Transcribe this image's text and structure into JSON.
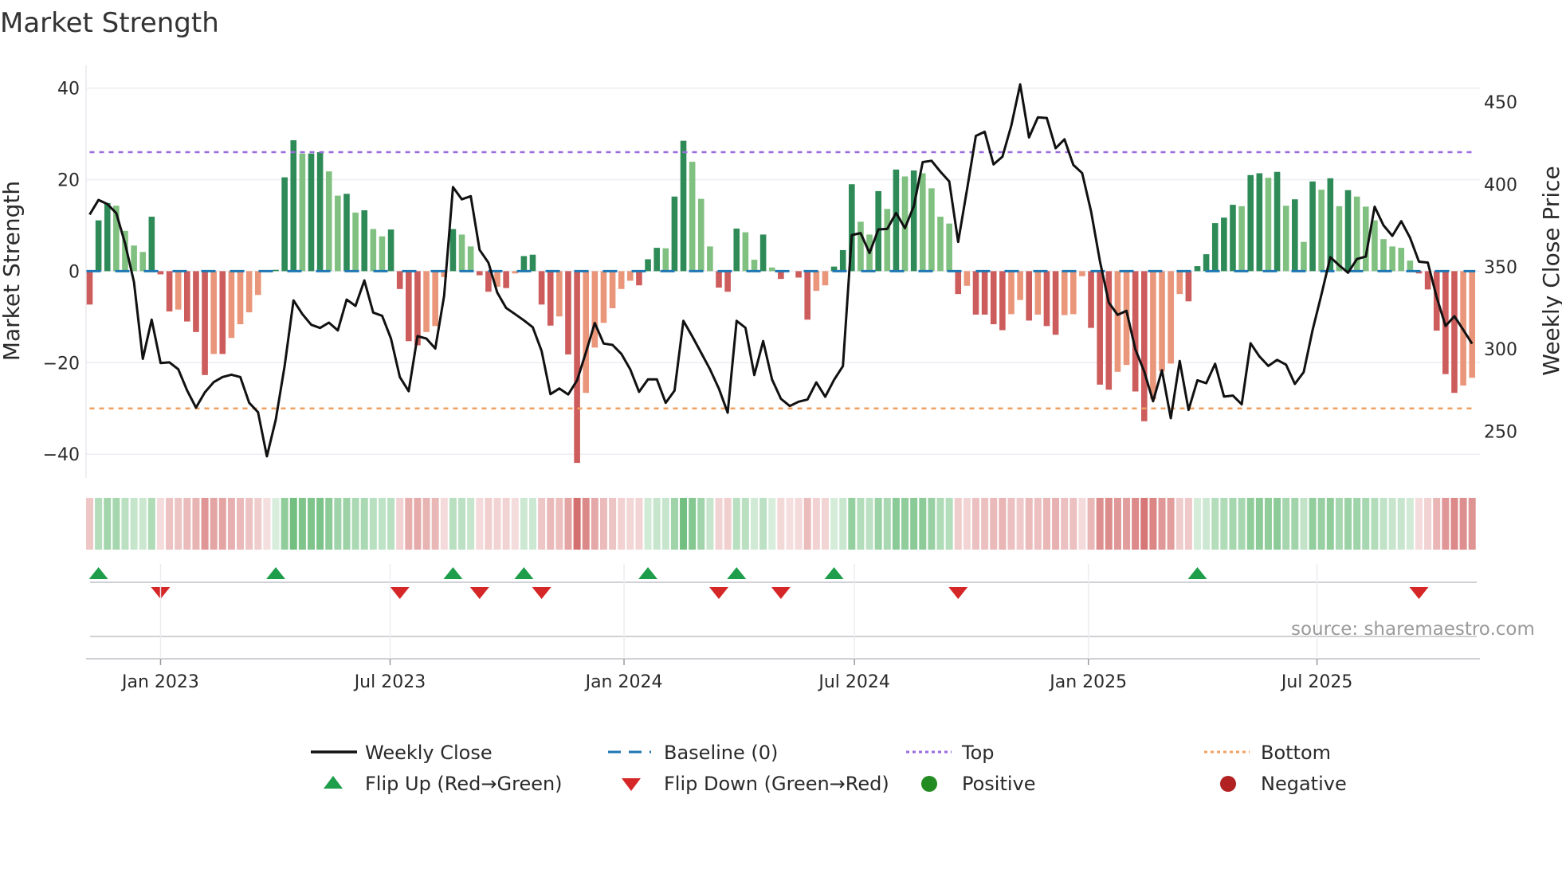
{
  "chart_data": {
    "type": "bar",
    "title": "Market Strength",
    "ylabel": "Market Strength",
    "y2label": "Weekly Close Price",
    "ylim": [
      -45,
      45
    ],
    "y2lim": [
      230,
      465
    ],
    "yticks": [
      40,
      20,
      0,
      -20,
      -40
    ],
    "yticklabels": [
      "40",
      "20",
      "0",
      "−20",
      "−40"
    ],
    "y2ticks": [
      450,
      400,
      350,
      300,
      250
    ],
    "x_unit": "week index",
    "xticks": [
      {
        "at": 8.0,
        "label": "Jan 2023"
      },
      {
        "at": 33.9,
        "label": "Jul 2023"
      },
      {
        "at": 60.3,
        "label": "Jan 2024"
      },
      {
        "at": 86.3,
        "label": "Jul 2024"
      },
      {
        "at": 112.7,
        "label": "Jan 2025"
      },
      {
        "at": 138.5,
        "label": "Jul 2025"
      }
    ],
    "top_level": 26,
    "bottom_level": -30,
    "baseline": 0,
    "strength": [
      -7.3,
      11.1,
      14.9,
      14.3,
      8.8,
      5.6,
      4.2,
      11.9,
      -0.7,
      -8.8,
      -8.4,
      -11.0,
      -13.3,
      -22.7,
      -18.1,
      -18.1,
      -14.6,
      -11.6,
      -9.0,
      -5.2,
      0,
      0.3,
      20.5,
      28.6,
      25.7,
      25.7,
      26.0,
      21.8,
      16.5,
      16.9,
      12.8,
      13.3,
      9.2,
      7.6,
      9.1,
      -3.9,
      -15.3,
      -16.2,
      -13.3,
      -12.0,
      -1.3,
      9.2,
      8.0,
      5.4,
      -0.9,
      -4.5,
      -3.4,
      -3.7,
      -0.5,
      3.3,
      3.6,
      -7.3,
      -11.9,
      -9.9,
      -18.2,
      -41.9,
      -26.6,
      -16.7,
      -11.3,
      -8.1,
      -3.9,
      -2.1,
      -3.1,
      2.6,
      5.1,
      5.0,
      16.3,
      28.5,
      23.9,
      15.8,
      5.4,
      -3.6,
      -4.5,
      9.3,
      8.5,
      2.5,
      8.0,
      0.8,
      -1.7,
      0,
      -1.4,
      -10.6,
      -4.3,
      -3.1,
      1.0,
      4.6,
      19.0,
      10.8,
      8.0,
      17.5,
      13.6,
      22.2,
      20.7,
      22.0,
      21.4,
      18.1,
      11.9,
      10.4,
      -5.0,
      -3.2,
      -9.5,
      -9.5,
      -11.6,
      -12.9,
      -9.4,
      -6.3,
      -10.8,
      -9.5,
      -12.0,
      -13.9,
      -9.6,
      -9.4,
      -1.1,
      -12.4,
      -24.8,
      -25.9,
      -22.0,
      -20.5,
      -26.3,
      -32.8,
      -28.0,
      -21.9,
      -20.2,
      -5.0,
      -6.6,
      1.1,
      3.7,
      10.5,
      11.7,
      14.5,
      14.2,
      21.0,
      21.4,
      20.4,
      21.7,
      14.3,
      15.7,
      6.4,
      19.6,
      17.8,
      20.3,
      14.2,
      17.7,
      16.3,
      14.1,
      11.1,
      7.0,
      5.4,
      5.1,
      2.3,
      -0.5,
      -4.0,
      -13.0,
      -22.5,
      -26.6,
      -25.0,
      -23.3
    ],
    "weekly_close": [
      381.6,
      390.5,
      388,
      382.5,
      364,
      340.7,
      294,
      317.8,
      291.5,
      291.9,
      287.7,
      274.8,
      264.4,
      273.7,
      279.9,
      283,
      284.4,
      283,
      267.3,
      261.6,
      234.8,
      257,
      289.5,
      329.5,
      321.2,
      314.7,
      312.8,
      316,
      311.3,
      330,
      326.2,
      341.6,
      322.1,
      320.2,
      306.3,
      283,
      274.4,
      307.8,
      306.3,
      300.3,
      332.3,
      398.3,
      390.9,
      392.8,
      360.2,
      352.4,
      334.2,
      324.9,
      321.2,
      317.4,
      313.2,
      298.8,
      272.6,
      276,
      272.4,
      280.9,
      297.9,
      315.8,
      303.3,
      302.5,
      297,
      287.7,
      274,
      281.6,
      281.6,
      267.3,
      274.7,
      317.1,
      307.6,
      297.7,
      287.7,
      276,
      261.3,
      317.1,
      312.9,
      284.2,
      304.8,
      281.6,
      269.8,
      265.4,
      268,
      269.3,
      279.7,
      271,
      281.3,
      289.6,
      369.2,
      370.4,
      358.3,
      372.6,
      372.9,
      382.6,
      373.4,
      386.8,
      413.5,
      414.3,
      407.7,
      401.8,
      365,
      396.8,
      429.4,
      431.9,
      412.1,
      416.8,
      435.7,
      460.7,
      428.5,
      440.6,
      440.3,
      421.9,
      427.3,
      411.8,
      406.8,
      383.5,
      353.3,
      328.2,
      320.7,
      323.2,
      299.7,
      286.3,
      268.3,
      287.1,
      258,
      292.7,
      263,
      281,
      279.2,
      291,
      271.1,
      271.7,
      266.4,
      303.5,
      295.5,
      289.7,
      293.4,
      290.5,
      278.8,
      286,
      311.6,
      333.2,
      355.8,
      350.8,
      346.3,
      354.6,
      356.1,
      386.4,
      375.1,
      368.7,
      377.6,
      367.5,
      353,
      352.5,
      331.5,
      314,
      319.9,
      311.6,
      303.2
    ],
    "flip_up_weeks": [
      1,
      21,
      41,
      49,
      63,
      73,
      84,
      125
    ],
    "flip_down_weeks": [
      8,
      35,
      44,
      51,
      71,
      78,
      98,
      150
    ],
    "legend": {
      "placement": "bottom",
      "items": [
        {
          "key": "close",
          "label": "Weekly Close"
        },
        {
          "key": "baseline",
          "label": "Baseline (0)"
        },
        {
          "key": "top",
          "label": "Top"
        },
        {
          "key": "bottom",
          "label": "Bottom"
        },
        {
          "key": "flipup",
          "label": "Flip Up (Red→Green)"
        },
        {
          "key": "flipdown",
          "label": "Flip Down (Green→Red)"
        },
        {
          "key": "positive",
          "label": "Positive"
        },
        {
          "key": "negative",
          "label": "Negative"
        }
      ]
    },
    "source": "source: sharemaestro.com"
  },
  "colors": {
    "pos_strong": "#2e8b57",
    "pos_weak": "#80c080",
    "neg_strong": "#cd5c5c",
    "neg_weak": "#e9967a",
    "baseline": "#1f77b4",
    "top": "#9b6be0",
    "bottom": "#f0a060",
    "close": "#111111",
    "flip_up": "#1e9e4a",
    "flip_down": "#d62728",
    "positive": "#228b22",
    "negative": "#b22222",
    "heat_pos": "46,160,67",
    "heat_neg": "200,70,70"
  }
}
